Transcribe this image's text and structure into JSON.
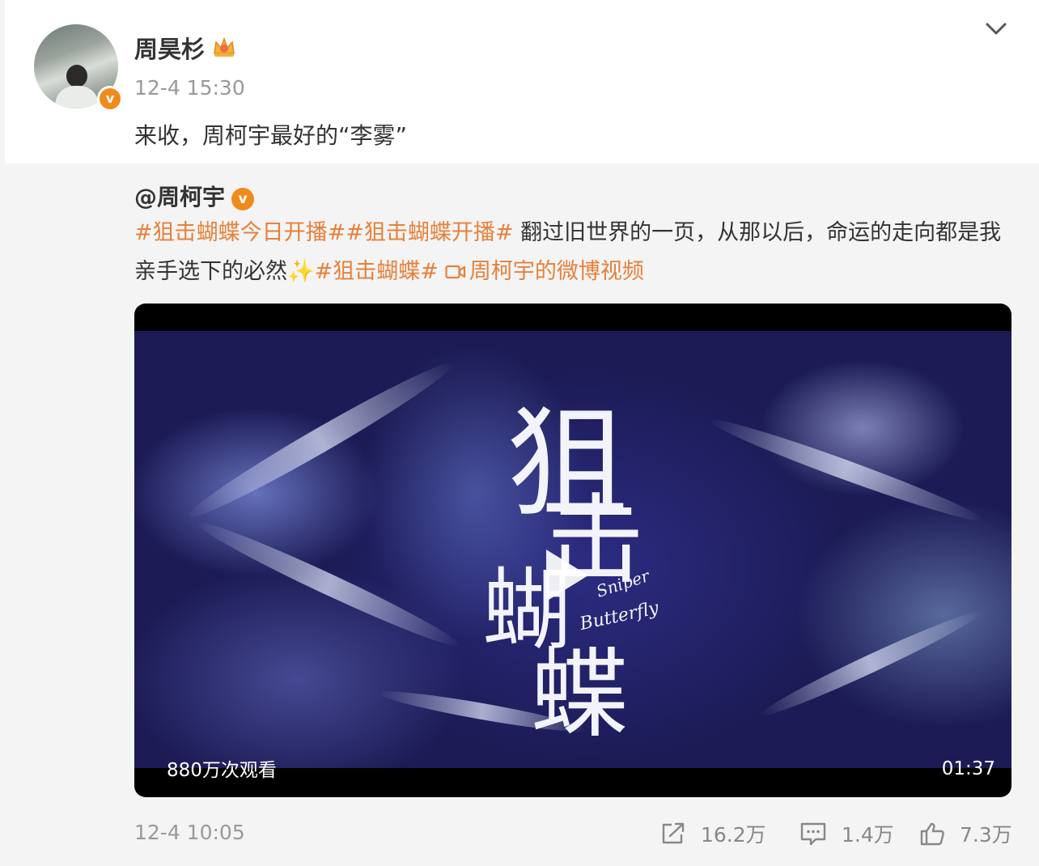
{
  "post": {
    "author": "周昊杉",
    "timestamp": "12-4 15:30",
    "text": "来收，周柯宇最好的“李雾”",
    "menu_icon": "chevron-down-icon",
    "crown_icon": "crown-icon",
    "verified_icon": "verified-icon"
  },
  "repost": {
    "mention": "@周柯宇",
    "tag1": "#狙击蝴蝶今日开播#",
    "tag2": "#狙击蝴蝶开播#",
    "text1": " 翻过旧世界的一页，从那以后，命运的走向都是我亲手选下的必然",
    "sparkle": "✨",
    "tag3": "#狙击蝴蝶#",
    "video_link": "周柯宇的微博视频",
    "video": {
      "title_chars": [
        "狙",
        "击",
        "蝴",
        "蝶"
      ],
      "title_en1": "Sniper",
      "title_en2": "Butterfly",
      "views": "880万次观看",
      "duration": "01:37"
    },
    "timestamp": "12-4 10:05",
    "actions": {
      "share": "16.2万",
      "comment": "1.4万",
      "like": "7.3万"
    }
  },
  "colors": {
    "accent": "#e8803a",
    "verified": "#f08a1d",
    "muted": "#999999"
  }
}
